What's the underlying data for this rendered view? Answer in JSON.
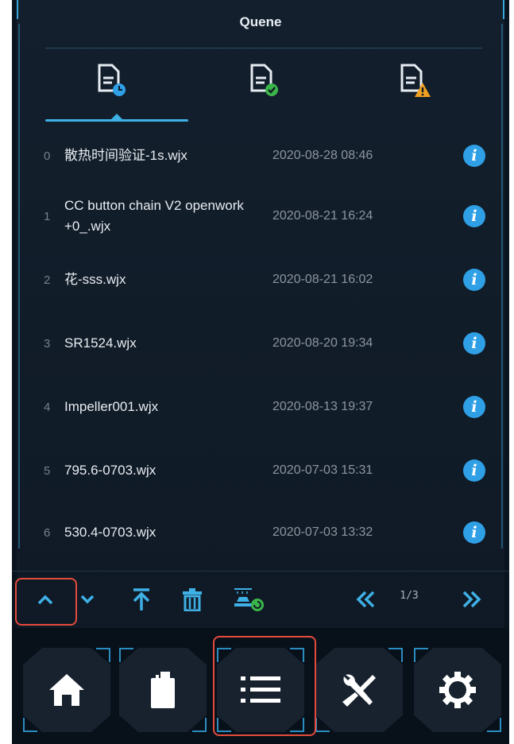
{
  "header": {
    "title": "Quene"
  },
  "tabs": [
    {
      "name": "pending-files",
      "icon": "file-clock-icon"
    },
    {
      "name": "completed-files",
      "icon": "file-check-icon"
    },
    {
      "name": "failed-files",
      "icon": "file-warning-icon"
    }
  ],
  "queue": [
    {
      "index": "0",
      "name": "散热时间验证-1s.wjx",
      "date": "2020-08-28 08:46"
    },
    {
      "index": "1",
      "name": "CC button chain V2 openwork +0_.wjx",
      "date": "2020-08-21 16:24"
    },
    {
      "index": "2",
      "name": "花-sss.wjx",
      "date": "2020-08-21 16:02"
    },
    {
      "index": "3",
      "name": "SR1524.wjx",
      "date": "2020-08-20 19:34"
    },
    {
      "index": "4",
      "name": "Impeller001.wjx",
      "date": "2020-08-13 19:37"
    },
    {
      "index": "5",
      "name": "795.6-0703.wjx",
      "date": "2020-07-03 15:31"
    },
    {
      "index": "6",
      "name": "530.4-0703.wjx",
      "date": "2020-07-03 13:32"
    }
  ],
  "info_label": "i",
  "toolbar": {
    "buttons": [
      "move-up-icon",
      "move-down-icon",
      "move-to-top-icon",
      "delete-icon",
      "print-start-icon"
    ],
    "page_indicator": "1/3"
  },
  "nav": {
    "buttons": [
      "home-icon",
      "filament-icon",
      "queue-list-icon",
      "tools-icon",
      "settings-icon"
    ]
  },
  "colors": {
    "accent": "#3fb0e6",
    "info": "#2f9fe6",
    "background": "#0a141f",
    "highlight": "#e44b3b"
  }
}
